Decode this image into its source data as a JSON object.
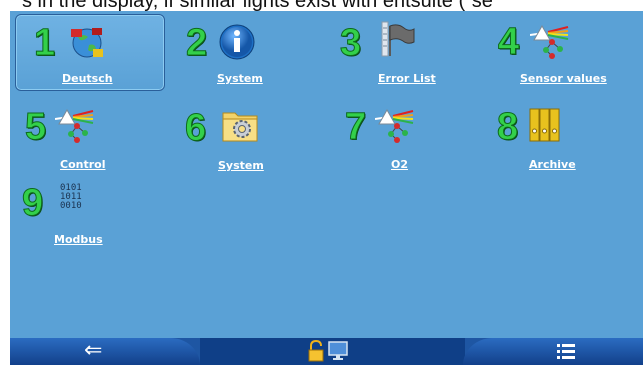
{
  "caption": "s in the display, if similar lights exist with entsuite (“se",
  "tiles": [
    {
      "number": "1",
      "label": "Deutsch",
      "icon": "globe-flags-icon"
    },
    {
      "number": "2",
      "label": "System",
      "icon": "info-icon"
    },
    {
      "number": "3",
      "label": "Error List",
      "icon": "flag-list-icon"
    },
    {
      "number": "4",
      "label": "Sensor values",
      "icon": "prism-network-icon"
    },
    {
      "number": "5",
      "label": "Control",
      "icon": "prism-network-icon"
    },
    {
      "number": "6",
      "label": "System",
      "icon": "gear-folder-icon"
    },
    {
      "number": "7",
      "label": "O2",
      "icon": "prism-network-icon"
    },
    {
      "number": "8",
      "label": "Archive",
      "icon": "binders-icon"
    },
    {
      "number": "9",
      "label": "Modbus",
      "icon": "binary-data-icon"
    }
  ],
  "binary_rows": [
    "0101",
    "1011",
    "0010"
  ],
  "bottom_bar": {
    "back_icon": "back-arrow-icon",
    "lock_icon": "unlock-icon",
    "monitor_icon": "monitor-icon",
    "menu_icon": "menu-list-icon"
  },
  "colors": {
    "screen": "#5aa1d6",
    "number_green": "#33d04a",
    "bar": "#1e56a3"
  }
}
